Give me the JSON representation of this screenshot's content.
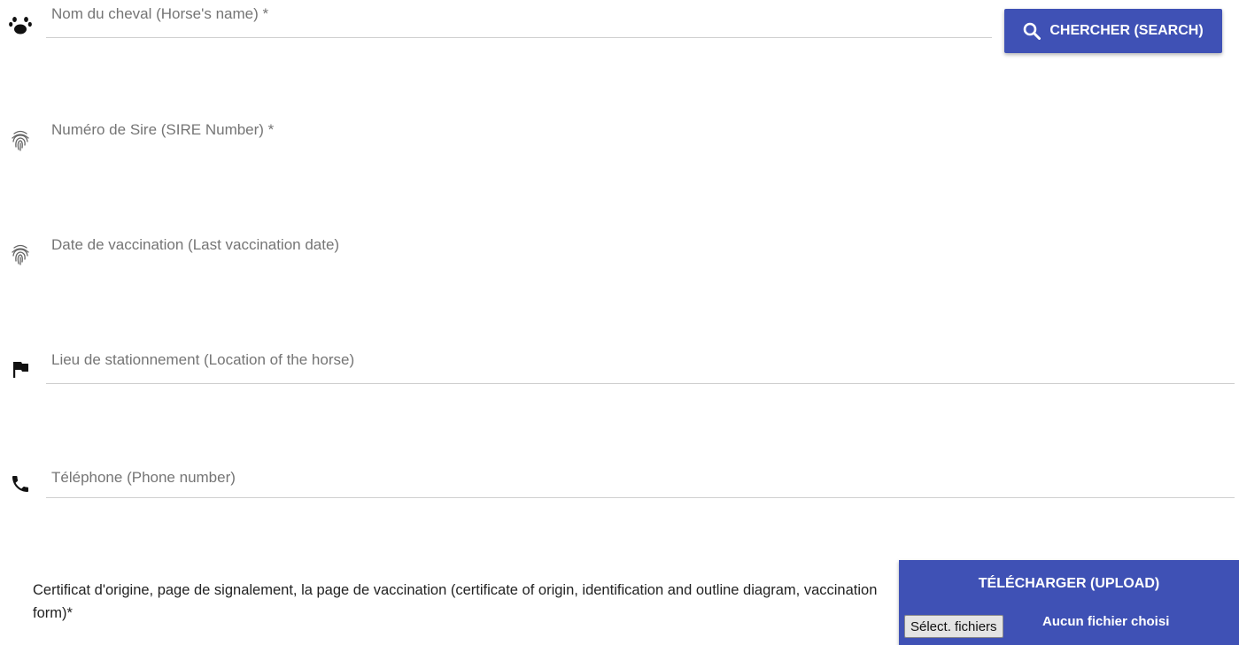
{
  "form": {
    "horse_name": {
      "label": "Nom du cheval (Horse's name) *",
      "value": ""
    },
    "sire_number": {
      "label": "Numéro de Sire (SIRE Number) *",
      "value": ""
    },
    "vaccination_date": {
      "label": "Date de vaccination (Last vaccination date)",
      "value": ""
    },
    "location": {
      "label": "Lieu de stationnement (Location of the horse)",
      "value": ""
    },
    "phone": {
      "label": "Téléphone (Phone number)",
      "value": ""
    }
  },
  "search_button": {
    "label": "CHERCHER (SEARCH)",
    "icon": "search-icon"
  },
  "certificate": {
    "text": "Certificat d'origine, page de signalement, la page de vaccination (certificate of origin, identification and outline diagram, vaccination form)*"
  },
  "upload": {
    "title": "TÉLÉCHARGER (UPLOAD)",
    "select_button": "Sélect. fichiers",
    "status": "Aucun fichier choisi"
  },
  "colors": {
    "primary": "#3f51b5",
    "label": "#757575",
    "underline": "#cfcfcf"
  }
}
